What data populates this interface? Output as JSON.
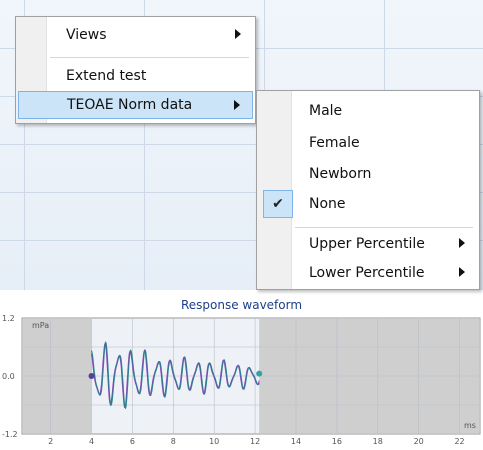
{
  "context_menu": {
    "items": [
      {
        "label": "Views",
        "has_submenu": true
      },
      {
        "label": "Extend test",
        "has_submenu": false
      },
      {
        "label": "TEOAE Norm data",
        "has_submenu": true,
        "highlighted": true
      }
    ]
  },
  "norm_submenu": {
    "items": [
      {
        "label": "Male",
        "checked": false,
        "has_submenu": false
      },
      {
        "label": "Female",
        "checked": false,
        "has_submenu": false
      },
      {
        "label": "Newborn",
        "checked": false,
        "has_submenu": false
      },
      {
        "label": "None",
        "checked": true,
        "has_submenu": false
      },
      {
        "label": "Upper Percentile",
        "checked": false,
        "has_submenu": true
      },
      {
        "label": "Lower Percentile",
        "checked": false,
        "has_submenu": true
      }
    ],
    "check_glyph": "✔"
  },
  "waveform": {
    "title": "Response waveform",
    "y_unit": "mPa",
    "x_unit": "ms",
    "y_ticks": [
      "1.2",
      "0.0",
      "-1.2"
    ],
    "x_ticks": [
      "2",
      "4",
      "6",
      "8",
      "10",
      "12",
      "14",
      "16",
      "18",
      "20",
      "22"
    ],
    "colors": {
      "trace_a": "#2f7f8f",
      "trace_b": "#8a3fbf",
      "start_marker": "#5b3d9a",
      "end_marker": "#2fa3a8",
      "shade": "#cfcfcf"
    }
  }
}
